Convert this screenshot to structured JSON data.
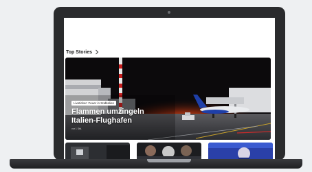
{
  "section": {
    "title": "Top Stories"
  },
  "hero": {
    "tag": "Liveticker: Feuer in Süditalien",
    "title": "Flammen umzingeln Italien-Flughafen",
    "meta": "vor 1 Std."
  },
  "icons": {
    "section_more": "chevron-right-icon"
  },
  "colors": {
    "bezel": "#2a2b2d",
    "screen_bg": "#ffffff",
    "hero_sky": "#0c0a0c",
    "fire_glow": "#c24a18",
    "plane_blue": "#1e3fa8"
  }
}
